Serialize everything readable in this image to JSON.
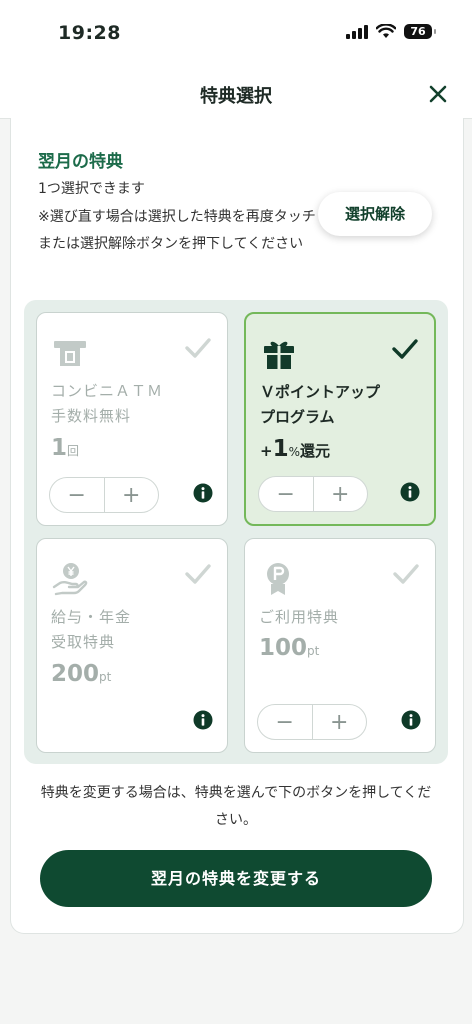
{
  "status_bar": {
    "time": "19:28",
    "battery": "76"
  },
  "header": {
    "title": "特典選択",
    "close_icon": "close-icon"
  },
  "section": {
    "title": "翌月の特典",
    "subtitle": "1つ選択できます",
    "note": "※選び直す場合は選択した特典を再度タッチまたは選択解除ボタンを押下してください",
    "deselect_label": "選択解除"
  },
  "benefits": [
    {
      "name_line1": "コンビニＡＴＭ",
      "name_line2": "手数料無料",
      "value_prefix": "",
      "value_number": "1",
      "value_unit": "回",
      "value_suffix": "",
      "icon": "atm-icon",
      "selected": false
    },
    {
      "name_line1": "Ｖポイントアップ",
      "name_line2": "プログラム",
      "value_prefix": "+",
      "value_number": "1",
      "value_unit": "%",
      "value_suffix": "還元",
      "icon": "gift-icon",
      "selected": true
    },
    {
      "name_line1": "給与・年金",
      "name_line2": "受取特典",
      "value_prefix": "",
      "value_number": "200",
      "value_unit": "pt",
      "value_suffix": "",
      "icon": "yen-hand-icon",
      "selected": false
    },
    {
      "name_line1": "ご利用特典",
      "name_line2": "",
      "value_prefix": "",
      "value_number": "100",
      "value_unit": "pt",
      "value_suffix": "",
      "icon": "point-badge-icon",
      "selected": false
    }
  ],
  "stepper": {
    "minus": "−",
    "plus": "+"
  },
  "footer": {
    "note": "特典を変更する場合は、特典を選んで下のボタンを押してください。",
    "change_label": "翌月の特典を変更する"
  },
  "colors": {
    "brand_dark": "#0f4a31",
    "selected_border": "#74b85a",
    "selected_bg": "#e3efe0"
  }
}
